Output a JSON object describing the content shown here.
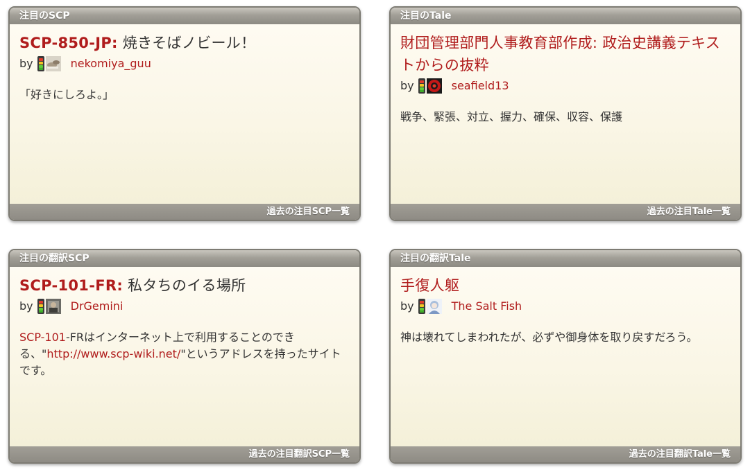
{
  "featured_scp": {
    "header": "注目のSCP",
    "code": "SCP-850-JP:",
    "title": " 焼きそばノビール！",
    "by": "by",
    "author": "nekomiya_guu",
    "summary": "「好きにしろよ。」",
    "footer": "過去の注目SCP一覧"
  },
  "featured_tale": {
    "header": "注目のTale",
    "title": "財団管理部門人事教育部作成: 政治史講義テキストからの抜粋",
    "by": "by",
    "author": "seafield13",
    "summary": "戦争、緊張、対立、握力、確保、収容、保護",
    "footer": "過去の注目Tale一覧"
  },
  "featured_translated_scp": {
    "header": "注目の翻訳SCP",
    "code": "SCP-101-FR:",
    "title": " 私タちのイる場所",
    "by": "by",
    "author": "DrGemini",
    "summary": {
      "link1": "SCP-101",
      "text1": "-FRはインターネット上で利用することのできる、\"",
      "link2": "http://www.scp-wiki.net/",
      "text2": "\"というアドレスを持ったサイトです。"
    },
    "footer": "過去の注目翻訳SCP一覧"
  },
  "featured_translated_tale": {
    "header": "注目の翻訳Tale",
    "title": "手復人躯",
    "by": "by",
    "author": "The Salt Fish",
    "summary": "神は壊れてしまわれたが、必ずや御身体を取り戻すだろう。",
    "footer": "過去の注目翻訳Tale一覧"
  },
  "colors": {
    "link_red": "#b01c1c",
    "header_gray": "#9a978f",
    "body_cream": "#faf6e6"
  },
  "icons": {
    "karma": "karma-meter-icon",
    "avatars": [
      "avatar-nekomiya_guu",
      "avatar-seafield13",
      "avatar-DrGemini",
      "avatar-The-Salt-Fish"
    ]
  }
}
